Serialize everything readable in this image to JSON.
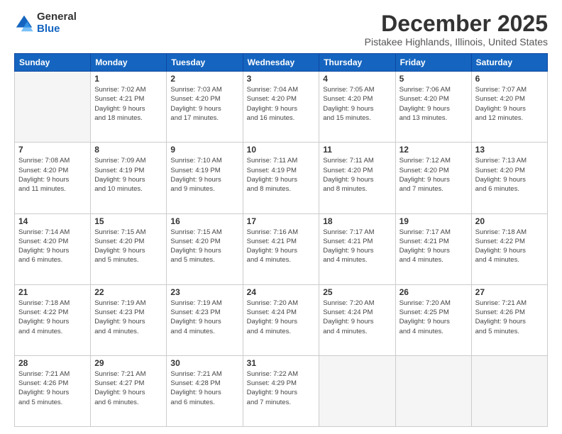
{
  "logo": {
    "general": "General",
    "blue": "Blue"
  },
  "title": "December 2025",
  "subtitle": "Pistakee Highlands, Illinois, United States",
  "days_header": [
    "Sunday",
    "Monday",
    "Tuesday",
    "Wednesday",
    "Thursday",
    "Friday",
    "Saturday"
  ],
  "weeks": [
    [
      {
        "day": "",
        "info": ""
      },
      {
        "day": "1",
        "info": "Sunrise: 7:02 AM\nSunset: 4:21 PM\nDaylight: 9 hours\nand 18 minutes."
      },
      {
        "day": "2",
        "info": "Sunrise: 7:03 AM\nSunset: 4:20 PM\nDaylight: 9 hours\nand 17 minutes."
      },
      {
        "day": "3",
        "info": "Sunrise: 7:04 AM\nSunset: 4:20 PM\nDaylight: 9 hours\nand 16 minutes."
      },
      {
        "day": "4",
        "info": "Sunrise: 7:05 AM\nSunset: 4:20 PM\nDaylight: 9 hours\nand 15 minutes."
      },
      {
        "day": "5",
        "info": "Sunrise: 7:06 AM\nSunset: 4:20 PM\nDaylight: 9 hours\nand 13 minutes."
      },
      {
        "day": "6",
        "info": "Sunrise: 7:07 AM\nSunset: 4:20 PM\nDaylight: 9 hours\nand 12 minutes."
      }
    ],
    [
      {
        "day": "7",
        "info": "Sunrise: 7:08 AM\nSunset: 4:20 PM\nDaylight: 9 hours\nand 11 minutes."
      },
      {
        "day": "8",
        "info": "Sunrise: 7:09 AM\nSunset: 4:19 PM\nDaylight: 9 hours\nand 10 minutes."
      },
      {
        "day": "9",
        "info": "Sunrise: 7:10 AM\nSunset: 4:19 PM\nDaylight: 9 hours\nand 9 minutes."
      },
      {
        "day": "10",
        "info": "Sunrise: 7:11 AM\nSunset: 4:19 PM\nDaylight: 9 hours\nand 8 minutes."
      },
      {
        "day": "11",
        "info": "Sunrise: 7:11 AM\nSunset: 4:20 PM\nDaylight: 9 hours\nand 8 minutes."
      },
      {
        "day": "12",
        "info": "Sunrise: 7:12 AM\nSunset: 4:20 PM\nDaylight: 9 hours\nand 7 minutes."
      },
      {
        "day": "13",
        "info": "Sunrise: 7:13 AM\nSunset: 4:20 PM\nDaylight: 9 hours\nand 6 minutes."
      }
    ],
    [
      {
        "day": "14",
        "info": "Sunrise: 7:14 AM\nSunset: 4:20 PM\nDaylight: 9 hours\nand 6 minutes."
      },
      {
        "day": "15",
        "info": "Sunrise: 7:15 AM\nSunset: 4:20 PM\nDaylight: 9 hours\nand 5 minutes."
      },
      {
        "day": "16",
        "info": "Sunrise: 7:15 AM\nSunset: 4:20 PM\nDaylight: 9 hours\nand 5 minutes."
      },
      {
        "day": "17",
        "info": "Sunrise: 7:16 AM\nSunset: 4:21 PM\nDaylight: 9 hours\nand 4 minutes."
      },
      {
        "day": "18",
        "info": "Sunrise: 7:17 AM\nSunset: 4:21 PM\nDaylight: 9 hours\nand 4 minutes."
      },
      {
        "day": "19",
        "info": "Sunrise: 7:17 AM\nSunset: 4:21 PM\nDaylight: 9 hours\nand 4 minutes."
      },
      {
        "day": "20",
        "info": "Sunrise: 7:18 AM\nSunset: 4:22 PM\nDaylight: 9 hours\nand 4 minutes."
      }
    ],
    [
      {
        "day": "21",
        "info": "Sunrise: 7:18 AM\nSunset: 4:22 PM\nDaylight: 9 hours\nand 4 minutes."
      },
      {
        "day": "22",
        "info": "Sunrise: 7:19 AM\nSunset: 4:23 PM\nDaylight: 9 hours\nand 4 minutes."
      },
      {
        "day": "23",
        "info": "Sunrise: 7:19 AM\nSunset: 4:23 PM\nDaylight: 9 hours\nand 4 minutes."
      },
      {
        "day": "24",
        "info": "Sunrise: 7:20 AM\nSunset: 4:24 PM\nDaylight: 9 hours\nand 4 minutes."
      },
      {
        "day": "25",
        "info": "Sunrise: 7:20 AM\nSunset: 4:24 PM\nDaylight: 9 hours\nand 4 minutes."
      },
      {
        "day": "26",
        "info": "Sunrise: 7:20 AM\nSunset: 4:25 PM\nDaylight: 9 hours\nand 4 minutes."
      },
      {
        "day": "27",
        "info": "Sunrise: 7:21 AM\nSunset: 4:26 PM\nDaylight: 9 hours\nand 5 minutes."
      }
    ],
    [
      {
        "day": "28",
        "info": "Sunrise: 7:21 AM\nSunset: 4:26 PM\nDaylight: 9 hours\nand 5 minutes."
      },
      {
        "day": "29",
        "info": "Sunrise: 7:21 AM\nSunset: 4:27 PM\nDaylight: 9 hours\nand 6 minutes."
      },
      {
        "day": "30",
        "info": "Sunrise: 7:21 AM\nSunset: 4:28 PM\nDaylight: 9 hours\nand 6 minutes."
      },
      {
        "day": "31",
        "info": "Sunrise: 7:22 AM\nSunset: 4:29 PM\nDaylight: 9 hours\nand 7 minutes."
      },
      {
        "day": "",
        "info": ""
      },
      {
        "day": "",
        "info": ""
      },
      {
        "day": "",
        "info": ""
      }
    ]
  ]
}
